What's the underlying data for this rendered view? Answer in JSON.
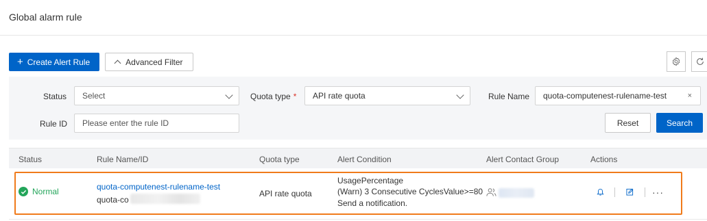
{
  "page": {
    "title": "Global alarm rule"
  },
  "toolbar": {
    "create_label": "Create Alert Rule",
    "advanced_filter_label": "Advanced Filter"
  },
  "filters": {
    "status_label": "Status",
    "status_value": "Select",
    "quota_type_label": "Quota type",
    "quota_type_required_mark": "*",
    "quota_type_value": "API rate quota",
    "rule_name_label": "Rule Name",
    "rule_name_value": "quota-computenest-rulename-test",
    "rule_id_label": "Rule ID",
    "rule_id_placeholder": "Please enter the rule ID",
    "reset_label": "Reset",
    "search_label": "Search"
  },
  "table": {
    "columns": [
      "Status",
      "Rule Name/ID",
      "Quota type",
      "Alert Condition",
      "Alert Contact Group",
      "Actions"
    ],
    "rows": [
      {
        "status": "Normal",
        "rule_name": "quota-computenest-rulename-test",
        "rule_id_prefix": "quota-co",
        "quota_type": "API rate quota",
        "condition_lines": [
          "UsagePercentage",
          "(Warn) 3 Consecutive CyclesValue>=80",
          "Send a notification."
        ]
      }
    ]
  },
  "colors": {
    "primary": "#0064c8",
    "success": "#23a55a",
    "highlight": "#f07a1a",
    "required": "#d93026"
  },
  "icons": [
    "plus-icon",
    "chevron-up-icon",
    "gear-icon",
    "refresh-icon",
    "chevron-down-icon",
    "close-icon",
    "check-circle-icon",
    "contact-group-icon",
    "bell-icon",
    "edit-icon",
    "more-icon"
  ]
}
